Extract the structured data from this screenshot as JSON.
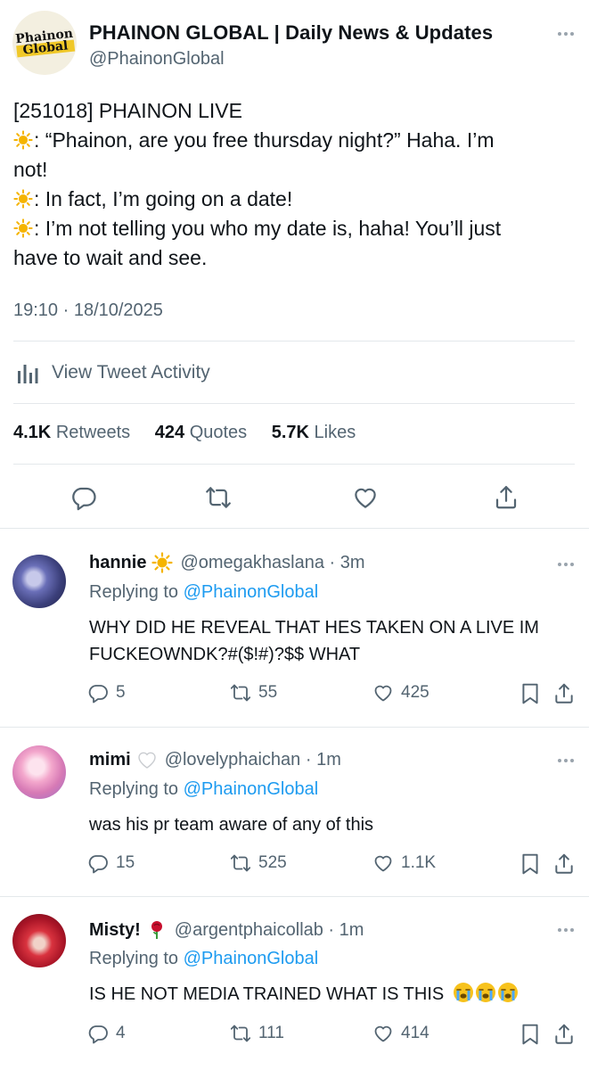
{
  "tweet": {
    "avatar_logo_line1": "Phainon",
    "avatar_logo_line2": "Global",
    "display_name": "PHAINON GLOBAL | Daily News & Updates",
    "handle": "@PhainonGlobal",
    "lines": [
      "[251018] PHAINON LIVE",
      ": “Phainon, are you free thursday night?” Haha. I’m",
      "not!",
      ": In fact, I’m going on a date!",
      ": I’m not telling you who my date is, haha! You’ll just",
      "have to wait and see."
    ],
    "timestamp": "19:10 · 18/10/2025",
    "activity_label": "View Tweet Activity",
    "stats": {
      "retweets_count": "4.1K",
      "retweets_label": "Retweets",
      "quotes_count": "424",
      "quotes_label": "Quotes",
      "likes_count": "5.7K",
      "likes_label": "Likes"
    },
    "actions": [
      "reply-icon",
      "retweet-icon",
      "like-icon",
      "share-icon"
    ]
  },
  "replies": [
    {
      "name": "hannie",
      "handle_time": "@omegakhaslana · 3m",
      "emoji": "sun",
      "replying_prefix": "Replying to",
      "replying_to": "@PhainonGlobal",
      "text": "WHY DID HE REVEAL THAT HES TAKEN ON A LIVE IM FUCKEOWNDK?#($!#)?$$ WHAT",
      "replies": "5",
      "retweets": "55",
      "likes": "425"
    },
    {
      "name": "mimi",
      "handle_time": "@lovelyphaichan · 1m",
      "emoji": "white-heart",
      "replying_prefix": "Replying to",
      "replying_to": "@PhainonGlobal",
      "text": "was his pr team aware of any of this",
      "replies": "15",
      "retweets": "525",
      "likes": "1.1K"
    },
    {
      "name": "Misty!",
      "handle_time": "@argentphaicollab · 1m",
      "emoji": "rose",
      "replying_prefix": "Replying to",
      "replying_to": "@PhainonGlobal",
      "text": "IS HE NOT MEDIA TRAINED WHAT IS THIS",
      "text_emoji": "loudly-crying-face x3",
      "replies": "4",
      "retweets": "111",
      "likes": "414"
    }
  ],
  "colors": {
    "text": "#0f1419",
    "secondary": "#536471",
    "link": "#1d9bf0",
    "divider": "#e4e8eb",
    "sun": "#f5b400"
  }
}
